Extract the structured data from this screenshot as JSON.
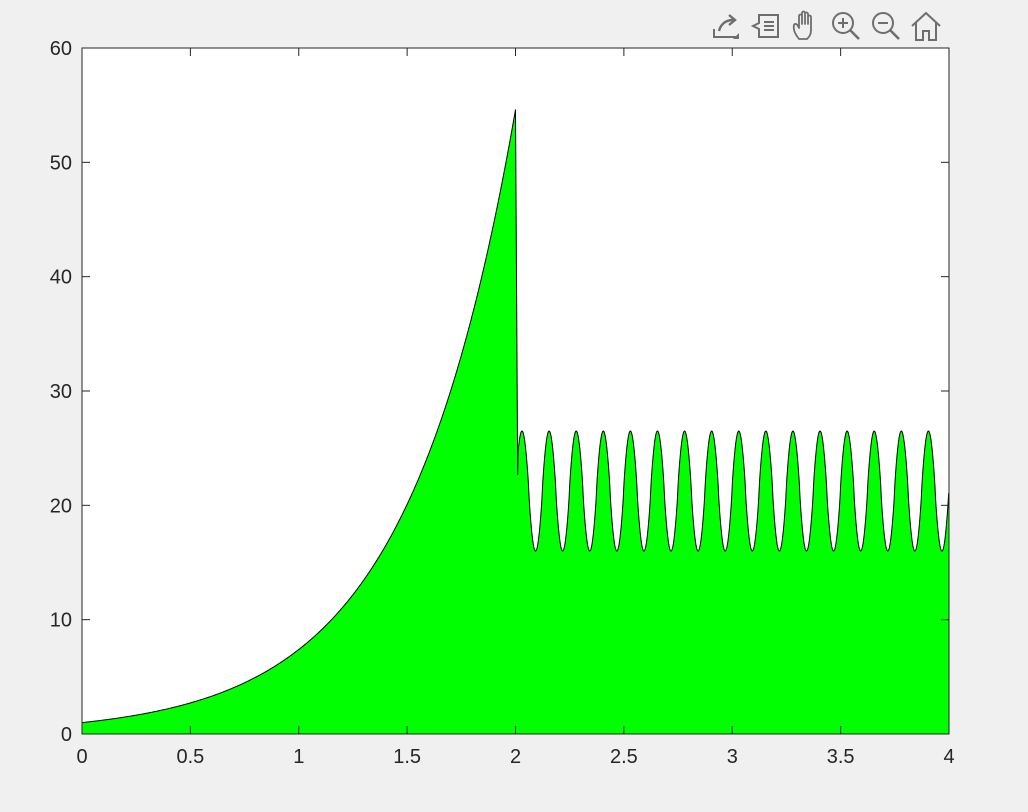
{
  "toolbar": {
    "buttons": [
      {
        "name": "export-button",
        "icon": "export-icon"
      },
      {
        "name": "data-tips-button",
        "icon": "data-tips-icon"
      },
      {
        "name": "pan-button",
        "icon": "pan-hand-icon"
      },
      {
        "name": "zoom-in-button",
        "icon": "zoom-in-icon"
      },
      {
        "name": "zoom-out-button",
        "icon": "zoom-out-icon"
      },
      {
        "name": "restore-view-button",
        "icon": "home-icon"
      }
    ]
  },
  "chart_data": {
    "type": "area",
    "title": "",
    "xlabel": "",
    "ylabel": "",
    "xlim": [
      0,
      4
    ],
    "ylim": [
      0,
      60
    ],
    "x_ticks": [
      0,
      0.5,
      1,
      1.5,
      2,
      2.5,
      3,
      3.5,
      4
    ],
    "x_tick_labels": [
      "0",
      "0.5",
      "1",
      "1.5",
      "2",
      "2.5",
      "3",
      "3.5",
      "4"
    ],
    "y_ticks": [
      0,
      10,
      20,
      30,
      40,
      50,
      60
    ],
    "y_tick_labels": [
      "0",
      "10",
      "20",
      "30",
      "40",
      "50",
      "60"
    ],
    "grid": false,
    "box": true,
    "fill_color": "#00ff00",
    "edge_color": "#000000",
    "series": [
      {
        "segments": [
          {
            "description": "exp(2x) for x in [0, 2]",
            "x": [
              0,
              0.25,
              0.5,
              0.75,
              1.0,
              1.25,
              1.5,
              1.75,
              2.0
            ],
            "y": [
              1.0,
              1.65,
              2.72,
              4.48,
              7.39,
              12.18,
              20.09,
              33.12,
              54.6
            ]
          },
          {
            "description": "periodic oscillation for x in (2, 4]",
            "x_start": 2.01,
            "x_end": 4.0,
            "y_min": 16.0,
            "y_max": 26.5,
            "first_value": 22.7,
            "peak_x": [
              2.03,
              2.155,
              2.28,
              2.405,
              2.53,
              2.655,
              2.78,
              2.905,
              3.03,
              3.155,
              3.28,
              3.405,
              3.53,
              3.655,
              3.78,
              3.905
            ],
            "trough_x": [
              2.09,
              2.215,
              2.34,
              2.465,
              2.59,
              2.715,
              2.84,
              2.965,
              3.09,
              3.215,
              3.34,
              3.465,
              3.59,
              3.715,
              3.84,
              3.965
            ],
            "end_value": 19.5
          }
        ]
      }
    ]
  }
}
